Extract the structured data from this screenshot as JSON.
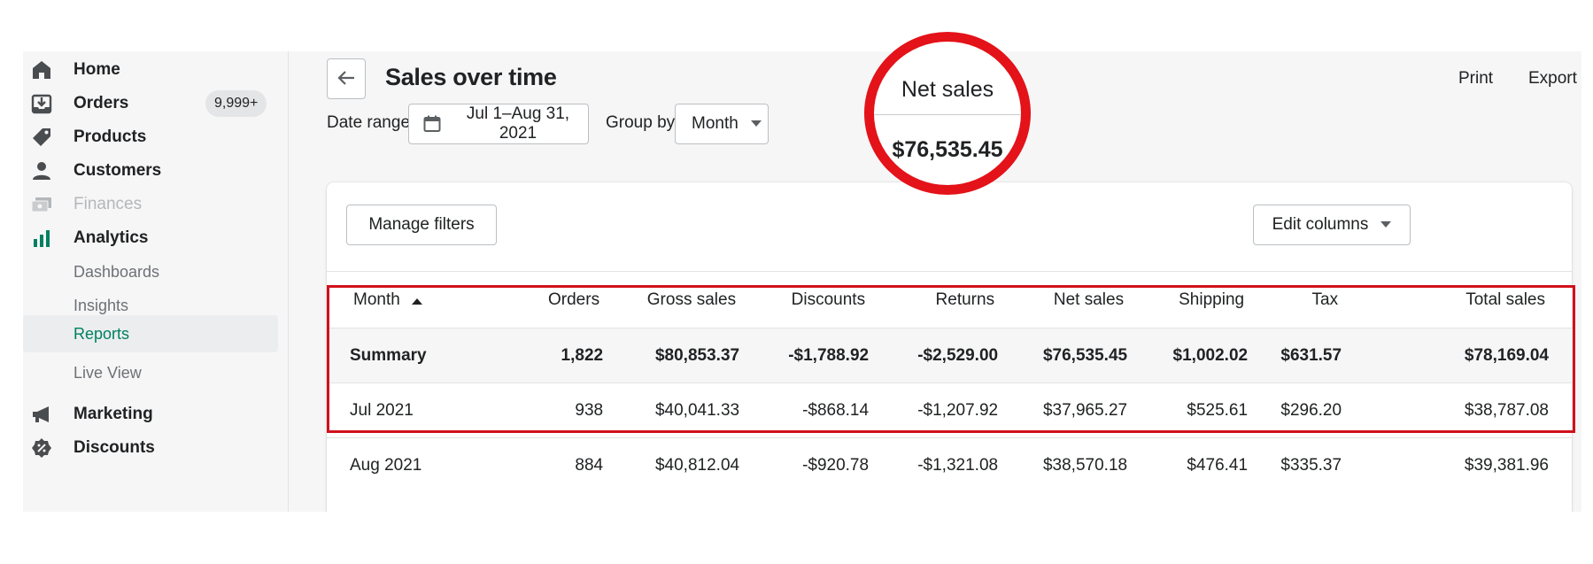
{
  "sidebar": {
    "items": [
      {
        "label": "Home",
        "icon": "home-icon"
      },
      {
        "label": "Orders",
        "icon": "orders-icon",
        "badge": "9,999+"
      },
      {
        "label": "Products",
        "icon": "tag-icon"
      },
      {
        "label": "Customers",
        "icon": "person-icon"
      },
      {
        "label": "Finances",
        "icon": "finances-icon"
      },
      {
        "label": "Analytics",
        "icon": "bar-chart-icon"
      },
      {
        "label": "Marketing",
        "icon": "megaphone-icon"
      },
      {
        "label": "Discounts",
        "icon": "discount-icon"
      }
    ],
    "analytics_sub": [
      {
        "label": "Dashboards"
      },
      {
        "label": "Insights"
      },
      {
        "label": "Reports"
      },
      {
        "label": "Live View"
      }
    ]
  },
  "header": {
    "title": "Sales over time",
    "print": "Print",
    "export": "Export"
  },
  "filters": {
    "date_range_label": "Date range",
    "date_range_value": "Jul 1–Aug 31, 2021",
    "group_by_label": "Group by",
    "group_by_value": "Month"
  },
  "card": {
    "manage_filters": "Manage filters",
    "edit_columns": "Edit columns"
  },
  "table": {
    "columns": [
      "Month",
      "Orders",
      "Gross sales",
      "Discounts",
      "Returns",
      "Net sales",
      "Shipping",
      "Tax",
      "Total sales"
    ],
    "summary": [
      "Summary",
      "1,822",
      "$80,853.37",
      "-$1,788.92",
      "-$2,529.00",
      "$76,535.45",
      "$1,002.02",
      "$631.57",
      "$78,169.04"
    ],
    "rows": [
      [
        "Jul 2021",
        "938",
        "$40,041.33",
        "-$868.14",
        "-$1,207.92",
        "$37,965.27",
        "$525.61",
        "$296.20",
        "$38,787.08"
      ],
      [
        "Aug 2021",
        "884",
        "$40,812.04",
        "-$920.78",
        "-$1,321.08",
        "$38,570.18",
        "$476.41",
        "$335.37",
        "$39,381.96"
      ]
    ]
  },
  "callout": {
    "label": "Net sales",
    "value": "$76,535.45"
  },
  "colors": {
    "accent": "#008060",
    "highlight": "#d1111b"
  }
}
